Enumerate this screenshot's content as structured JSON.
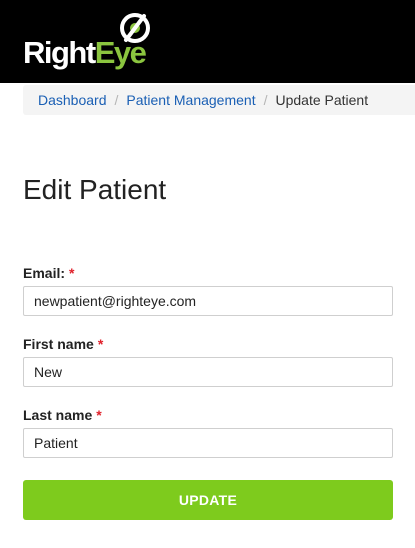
{
  "header": {
    "logo_part1": "Right",
    "logo_part2": "Eye",
    "colors": {
      "background": "#000000",
      "brand_green": "#8bc53f"
    }
  },
  "breadcrumb": {
    "items": [
      "Dashboard",
      "Patient Management"
    ],
    "separator": "/",
    "current": "Update Patient"
  },
  "page": {
    "title": "Edit Patient"
  },
  "form": {
    "email": {
      "label": "Email:",
      "required_mark": "*",
      "value": "newpatient@righteye.com"
    },
    "first_name": {
      "label": "First name",
      "required_mark": "*",
      "value": "New"
    },
    "last_name": {
      "label": "Last name",
      "required_mark": "*",
      "value": "Patient"
    },
    "submit_label": "UPDATE"
  },
  "colors": {
    "link": "#1a5fb4",
    "required": "#e0212b",
    "button": "#7ecb1d"
  }
}
